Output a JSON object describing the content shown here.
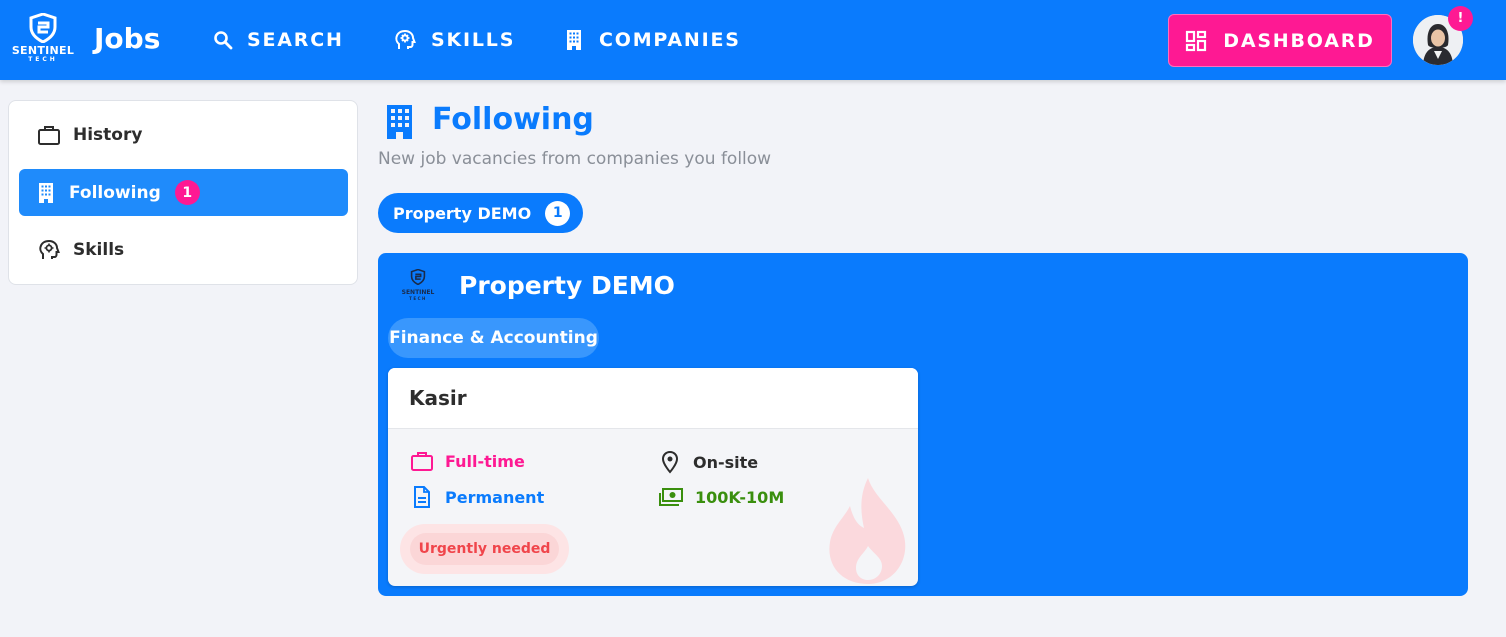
{
  "brand": {
    "logo_line1": "SENTINEL",
    "logo_line2": "TECH",
    "app_title": "Jobs"
  },
  "nav": {
    "items": [
      {
        "label": "SEARCH",
        "icon": "search-icon"
      },
      {
        "label": "SKILLS",
        "icon": "head-gear-icon"
      },
      {
        "label": "COMPANIES",
        "icon": "building-icon"
      }
    ],
    "dashboard_label": "DASHBOARD",
    "dashboard_icon": "dashboard-grid-icon",
    "notification_mark": "!"
  },
  "sidebar": {
    "items": [
      {
        "label": "History",
        "icon": "briefcase-icon"
      },
      {
        "label": "Following",
        "icon": "building-icon",
        "badge": "1",
        "active": true
      },
      {
        "label": "Skills",
        "icon": "head-gear-icon"
      }
    ]
  },
  "main": {
    "title": "Following",
    "subtitle": "New job vacancies from companies you follow",
    "company_chip": {
      "label": "Property DEMO",
      "count": "1"
    },
    "company": {
      "name": "Property DEMO",
      "logo_line1": "SENTINEL",
      "logo_line2": "TECH",
      "category": "Finance & Accounting",
      "job": {
        "title": "Kasir",
        "employment_type": "Full-time",
        "contract_type": "Permanent",
        "location_type": "On-site",
        "salary": "100K-10M",
        "urgent_label": "Urgently needed"
      }
    }
  },
  "colors": {
    "primary": "#0a7bfd",
    "accent": "#fe1993",
    "salary_green": "#3a8f0e",
    "urgent_red": "#f0454b"
  }
}
